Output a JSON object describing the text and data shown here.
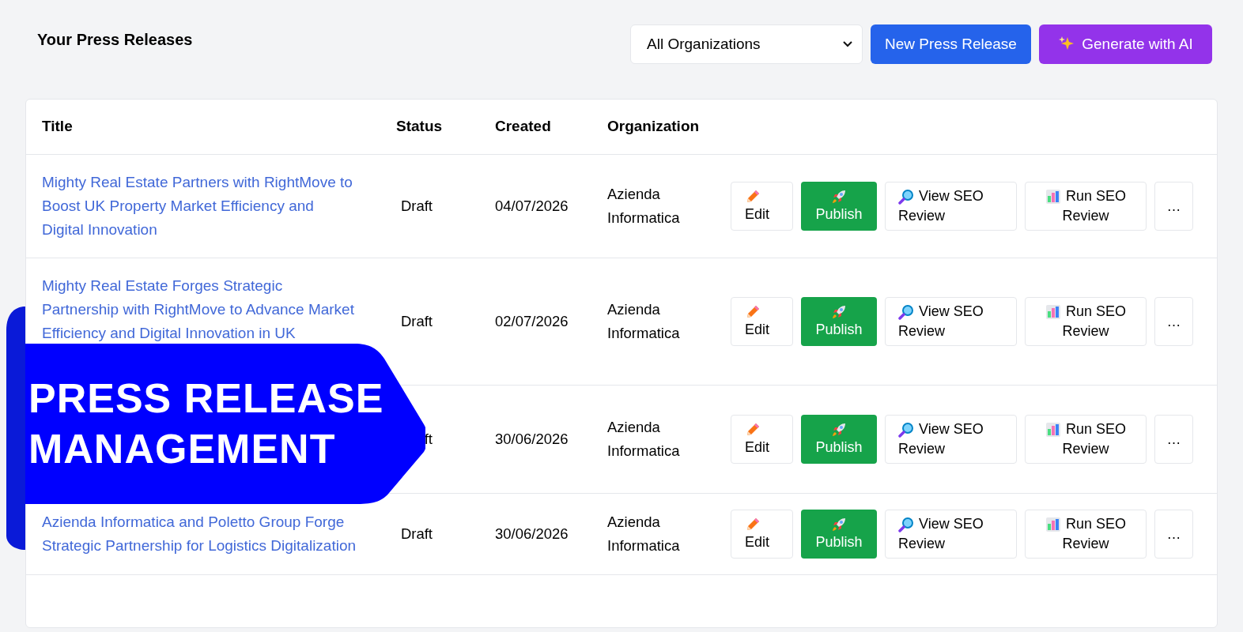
{
  "heading": "Your Press Releases",
  "filter": {
    "value": "All Organizations"
  },
  "header_buttons": [
    {
      "kind": "new",
      "label": "New Press Release"
    },
    {
      "kind": "ai",
      "label": "Generate with AI"
    }
  ],
  "table": {
    "columns": [
      "Title",
      "Status",
      "Created",
      "Organization"
    ],
    "rows": [
      {
        "title": "Mighty Real Estate Partners with RightMove to Boost UK Property Market Efficiency and Digital Innovation",
        "status": "Draft",
        "created": "04/07/2026",
        "organization": "Azienda Informatica",
        "actions": [
          {
            "kind": "edit",
            "label": "Edit"
          },
          {
            "kind": "publish",
            "label": "Publish"
          },
          {
            "kind": "view_seo",
            "label": "View SEO Review"
          },
          {
            "kind": "run_seo",
            "label": "Run SEO Review"
          },
          {
            "kind": "more",
            "label": "…"
          }
        ]
      },
      {
        "title": "Mighty Real Estate Forges Strategic Partnership with RightMove to Advance Market Efficiency and Digital Innovation in UK",
        "status": "Draft",
        "created": "02/07/2026",
        "organization": "Azienda Informatica",
        "actions": [
          {
            "kind": "edit",
            "label": "Edit"
          },
          {
            "kind": "publish",
            "label": "Publish"
          },
          {
            "kind": "view_seo",
            "label": "View SEO Review"
          },
          {
            "kind": "run_seo",
            "label": "Run SEO Review"
          },
          {
            "kind": "more",
            "label": "…"
          }
        ]
      },
      {
        "status": "ft",
        "created": "30/06/2026",
        "organization": "Azienda Informatica",
        "actions": [
          {
            "kind": "edit",
            "label": "Edit"
          },
          {
            "kind": "publish",
            "label": "Publish"
          },
          {
            "kind": "view_seo",
            "label": "View SEO Review"
          },
          {
            "kind": "run_seo",
            "label": "Run SEO Review"
          },
          {
            "kind": "more",
            "label": "…"
          }
        ]
      },
      {
        "title": "Azienda Informatica and Poletto Group Forge Strategic Partnership for Logistics Digitalization",
        "status": "Draft",
        "created": "30/06/2026",
        "organization": "Azienda Informatica",
        "actions": [
          {
            "kind": "edit",
            "label": "Edit"
          },
          {
            "kind": "publish",
            "label": "Publish"
          },
          {
            "kind": "view_seo",
            "label": "View SEO Review"
          },
          {
            "kind": "run_seo",
            "label": "Run SEO Review"
          },
          {
            "kind": "more",
            "label": "…"
          }
        ]
      }
    ]
  },
  "banner": {
    "lines": [
      "PRESS RELEASE",
      "MANAGEMENT"
    ]
  }
}
